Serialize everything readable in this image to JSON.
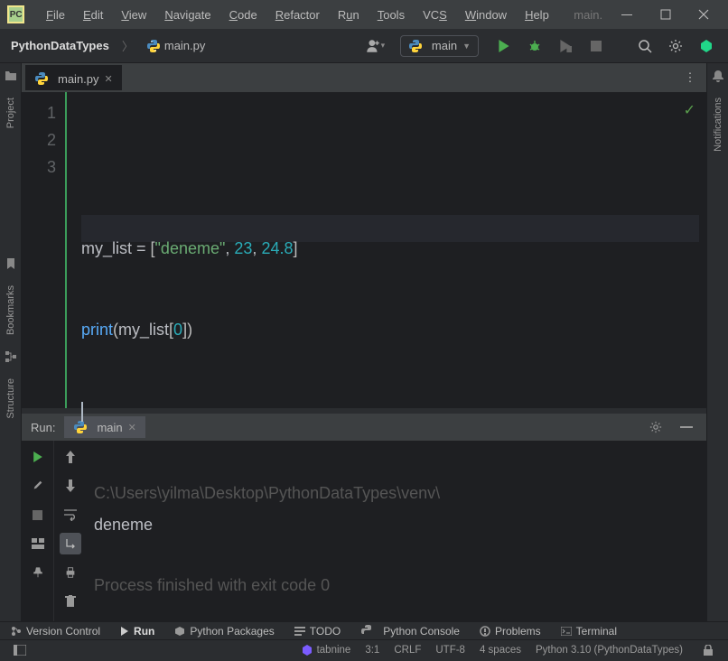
{
  "titlebar": {
    "menus": [
      "File",
      "Edit",
      "View",
      "Navigate",
      "Code",
      "Refactor",
      "Run",
      "Tools",
      "VCS",
      "Window",
      "Help"
    ],
    "project_label": "main."
  },
  "breadcrumb": {
    "root": "PythonDataTypes",
    "file": "main.py"
  },
  "run_config": {
    "name": "main"
  },
  "tabs": [
    {
      "label": "main.py"
    }
  ],
  "editor": {
    "lines": [
      "1",
      "2",
      "3"
    ],
    "code": {
      "l1_id": "my_list",
      "l1_eq": " = ",
      "l1_b1": "[",
      "l1_str": "\"deneme\"",
      "l1_c1": ", ",
      "l1_n1": "23",
      "l1_c2": ", ",
      "l1_n2": "24.8",
      "l1_b2": "]",
      "l2_fn": "print",
      "l2_p1": "(",
      "l2_id": "my_list",
      "l2_b1": "[",
      "l2_n": "0",
      "l2_b2": "]",
      "l2_p2": ")"
    }
  },
  "left_rail": {
    "project": "Project",
    "bookmarks": "Bookmarks",
    "structure": "Structure"
  },
  "right_rail": {
    "notifications": "Notifications"
  },
  "run_panel": {
    "title": "Run:",
    "tab": "main",
    "out_path": "C:\\Users\\yilma\\Desktop\\PythonDataTypes\\venv\\",
    "out_line": "deneme",
    "exit": "Process finished with exit code 0"
  },
  "tool_windows": {
    "vcs": "Version Control",
    "run": "Run",
    "pkg": "Python Packages",
    "todo": "TODO",
    "console": "Python Console",
    "problems": "Problems",
    "terminal": "Terminal"
  },
  "status": {
    "tabnine": "tabnine",
    "pos": "3:1",
    "sep": "CRLF",
    "enc": "UTF-8",
    "indent": "4 spaces",
    "interp": "Python 3.10 (PythonDataTypes)"
  }
}
